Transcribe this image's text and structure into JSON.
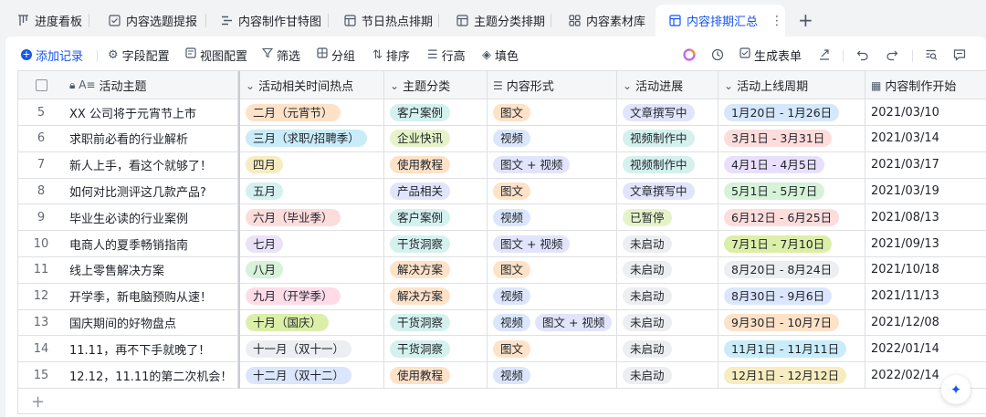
{
  "tabs": [
    {
      "label": "进度看板",
      "icon": "kanban-icon"
    },
    {
      "label": "内容选题提报",
      "icon": "form-icon"
    },
    {
      "label": "内容制作甘特图",
      "icon": "gantt-icon"
    },
    {
      "label": "节日热点排期",
      "icon": "table-icon"
    },
    {
      "label": "主题分类排期",
      "icon": "table-icon"
    },
    {
      "label": "内容素材库",
      "icon": "gallery-icon"
    },
    {
      "label": "内容排期汇总",
      "icon": "table-icon",
      "active": true
    }
  ],
  "tab_more": "⋮",
  "tab_add": "+",
  "toolbar": {
    "add_record": "添加记录",
    "field_config": "字段配置",
    "view_config": "视图配置",
    "filter": "筛选",
    "group": "分组",
    "sort": "排序",
    "row_height": "行高",
    "fill_color": "填色",
    "generate_form": "生成表单"
  },
  "columns": [
    {
      "label": "活动主题",
      "icon": "lock-text-icon"
    },
    {
      "label": "活动相关时间热点",
      "icon": "single-select-icon"
    },
    {
      "label": "主题分类",
      "icon": "single-select-icon"
    },
    {
      "label": "内容形式",
      "icon": "multi-select-icon"
    },
    {
      "label": "活动进展",
      "icon": "single-select-icon"
    },
    {
      "label": "活动上线周期",
      "icon": "single-select-icon"
    },
    {
      "label": "内容制作开始",
      "icon": "calendar-icon"
    }
  ],
  "rows": [
    {
      "n": "5",
      "topic": "XX 公司将于元宵节上市",
      "hot": {
        "t": "二月（元宵节）",
        "c": "#fde2c8"
      },
      "cat": {
        "t": "客户案例",
        "c": "#d4f1ee"
      },
      "forms": [
        {
          "t": "图文",
          "c": "#fde2c8"
        }
      ],
      "prog": {
        "t": "文章撰写中",
        "c": "#e2e4fb"
      },
      "period": {
        "t": "1月20日 - 1月26日",
        "c": "#d4e7fb"
      },
      "start": "2021/03/10"
    },
    {
      "n": "6",
      "topic": "求职前必看的行业解析",
      "hot": {
        "t": "三月（求职/招聘季）",
        "c": "#c9ecf8"
      },
      "cat": {
        "t": "企业快讯",
        "c": "#e6f3c8"
      },
      "forms": [
        {
          "t": "视频",
          "c": "#dbe6fc"
        }
      ],
      "prog": {
        "t": "视频制作中",
        "c": "#d4f1ee"
      },
      "period": {
        "t": "3月1日 - 3月31日",
        "c": "#fddcdc"
      },
      "start": "2021/03/14"
    },
    {
      "n": "7",
      "topic": "新人上手，看这个就够了！",
      "hot": {
        "t": "四月",
        "c": "#f7ecc0"
      },
      "cat": {
        "t": "使用教程",
        "c": "#fde2c8"
      },
      "forms": [
        {
          "t": "图文 + 视频",
          "c": "#e2e4fb"
        }
      ],
      "prog": {
        "t": "视频制作中",
        "c": "#d4f1ee"
      },
      "period": {
        "t": "4月1日 - 4月5日",
        "c": "#e9dffb"
      },
      "start": "2021/03/17"
    },
    {
      "n": "8",
      "topic": "如何对比测评这几款产品?",
      "hot": {
        "t": "五月",
        "c": "#d4f1ee"
      },
      "cat": {
        "t": "产品相关",
        "c": "#e2e4fb"
      },
      "forms": [
        {
          "t": "图文",
          "c": "#fde2c8"
        }
      ],
      "prog": {
        "t": "文章撰写中",
        "c": "#e2e4fb"
      },
      "period": {
        "t": "5月1日 - 5月7日",
        "c": "#d6f2d8"
      },
      "start": "2021/03/19"
    },
    {
      "n": "9",
      "topic": "毕业生必读的行业案例",
      "hot": {
        "t": "六月（毕业季）",
        "c": "#fddcdc"
      },
      "cat": {
        "t": "客户案例",
        "c": "#d4f1ee"
      },
      "forms": [
        {
          "t": "视频",
          "c": "#dbe6fc"
        }
      ],
      "prog": {
        "t": "已暂停",
        "c": "#e6f3c8"
      },
      "period": {
        "t": "6月12日 - 6月25日",
        "c": "#fddcdc"
      },
      "start": "2021/08/13"
    },
    {
      "n": "10",
      "topic": "电商人的夏季畅销指南",
      "hot": {
        "t": "七月",
        "c": "#ebe2f8"
      },
      "cat": {
        "t": "干货洞察",
        "c": "#d4f1ee"
      },
      "forms": [
        {
          "t": "图文 + 视频",
          "c": "#e2e4fb"
        }
      ],
      "prog": {
        "t": "未启动",
        "c": "#eceef1"
      },
      "period": {
        "t": "7月1日 - 7月10日",
        "c": "#dcefa8"
      },
      "start": "2021/09/13"
    },
    {
      "n": "11",
      "topic": "线上零售解决方案",
      "hot": {
        "t": "八月",
        "c": "#d6f2d8"
      },
      "cat": {
        "t": "解决方案",
        "c": "#fde2c8"
      },
      "forms": [
        {
          "t": "图文",
          "c": "#fde2c8"
        }
      ],
      "prog": {
        "t": "未启动",
        "c": "#eceef1"
      },
      "period": {
        "t": "8月20日 - 8月24日",
        "c": "#eceef1"
      },
      "start": "2021/10/18"
    },
    {
      "n": "12",
      "topic": "开学季，新电脑预购从速！",
      "hot": {
        "t": "九月（开学季）",
        "c": "#fddce8"
      },
      "cat": {
        "t": "解决方案",
        "c": "#fde2c8"
      },
      "forms": [
        {
          "t": "视频",
          "c": "#dbe6fc"
        }
      ],
      "prog": {
        "t": "未启动",
        "c": "#eceef1"
      },
      "period": {
        "t": "8月30日 - 9月6日",
        "c": "#dbe6fc"
      },
      "start": "2021/11/13"
    },
    {
      "n": "13",
      "topic": "国庆期间的好物盘点",
      "hot": {
        "t": "十月（国庆）",
        "c": "#dcefa8"
      },
      "cat": {
        "t": "干货洞察",
        "c": "#d4f1ee"
      },
      "forms": [
        {
          "t": "视频",
          "c": "#dbe6fc"
        },
        {
          "t": "图文 + 视频",
          "c": "#e2e4fb"
        }
      ],
      "prog": {
        "t": "未启动",
        "c": "#eceef1"
      },
      "period": {
        "t": "9月30日 - 10月7日",
        "c": "#fde2c8"
      },
      "start": "2021/12/08"
    },
    {
      "n": "14",
      "topic": "11.11，再不下手就晚了！",
      "hot": {
        "t": "十一月（双十一）",
        "c": "#eceef1"
      },
      "cat": {
        "t": "干货洞察",
        "c": "#d4f1ee"
      },
      "forms": [
        {
          "t": "图文",
          "c": "#fde2c8"
        }
      ],
      "prog": {
        "t": "未启动",
        "c": "#eceef1"
      },
      "period": {
        "t": "11月1日 - 11月11日",
        "c": "#c9ecf8"
      },
      "start": "2022/01/14"
    },
    {
      "n": "15",
      "topic": "12.12，11.11的第二次机会！",
      "hot": {
        "t": "十二月（双十二）",
        "c": "#dbe6fc"
      },
      "cat": {
        "t": "使用教程",
        "c": "#fde2c8"
      },
      "forms": [
        {
          "t": "视频",
          "c": "#dbe6fc"
        }
      ],
      "prog": {
        "t": "未启动",
        "c": "#eceef1"
      },
      "period": {
        "t": "12月1日 - 12月12日",
        "c": "#f7ecc0"
      },
      "start": "2022/02/14"
    }
  ],
  "add_row": "+",
  "colors": {
    "accent": "#1456f0",
    "border": "#dee0e3",
    "header_bg": "#f5f6f7"
  }
}
